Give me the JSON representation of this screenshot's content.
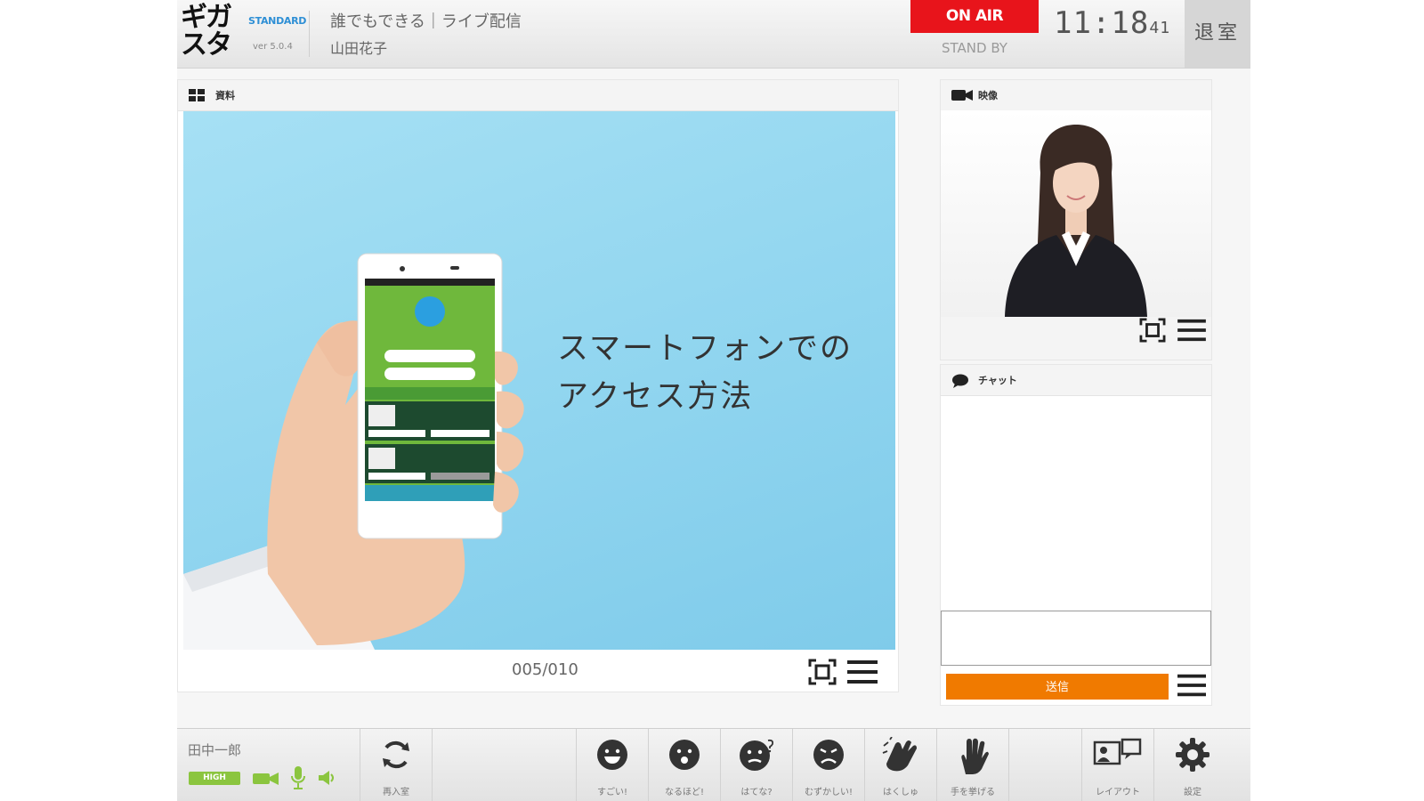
{
  "header": {
    "logo_line1": "ギガ",
    "logo_line2": "スタ",
    "edition": "STANDARD",
    "version": "ver 5.0.4",
    "course_title": "誰でもできる｜ライブ配信",
    "presenter": "山田花子",
    "on_air_label": "ON AIR",
    "status": "STAND BY",
    "clock_hm": "11:18",
    "clock_sec": "41",
    "exit_label": "退室"
  },
  "material": {
    "panel_label": "資料",
    "slide_title_line1": "スマートフォンでの",
    "slide_title_line2": "アクセス方法",
    "page_counter": "005/010"
  },
  "video": {
    "panel_label": "映像"
  },
  "chat": {
    "panel_label": "チャット",
    "input_value": "",
    "send_label": "送信"
  },
  "bottom": {
    "user_name": "田中一郎",
    "quality": "HIGH",
    "reconnect_label": "再入室",
    "reactions": [
      {
        "label": "すごい!"
      },
      {
        "label": "なるほど!"
      },
      {
        "label": "はてな?"
      },
      {
        "label": "むずかしい!"
      },
      {
        "label": "はくしゅ"
      },
      {
        "label": "手を挙げる"
      }
    ],
    "layout_label": "レイアウト",
    "settings_label": "設定"
  },
  "colors": {
    "on_air": "#e8141b",
    "send": "#f07a00",
    "quality_badge": "#8bc53f",
    "mic_icon": "#8bc53f",
    "slide_bg": "#99d8f0",
    "edition_text": "#2e8fd5"
  }
}
